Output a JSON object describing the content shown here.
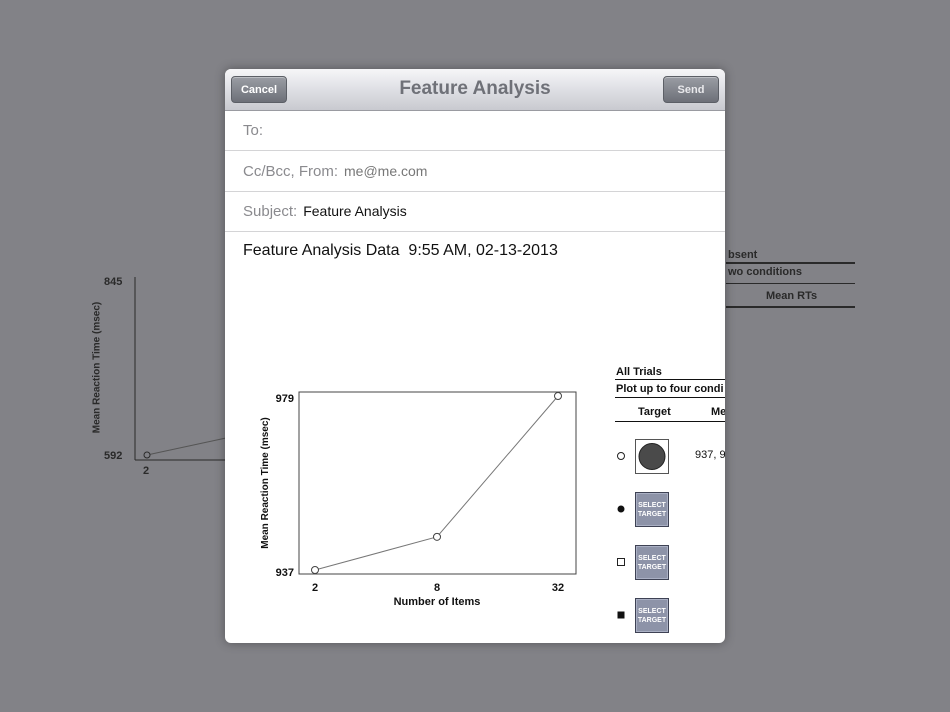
{
  "background_app": {
    "chart": {
      "ylabel": "Mean Reaction Time (msec)",
      "y_top_tick": "845",
      "y_bottom_tick": "592",
      "x_first_tick": "2"
    },
    "panel": {
      "line1": "bsent",
      "line2": "wo conditions",
      "line3": "Mean RTs"
    }
  },
  "mail": {
    "cancel_label": "Cancel",
    "title": "Feature Analysis",
    "send_label": "Send",
    "to_label": "To:",
    "to_value": "",
    "ccbcc_label": "Cc/Bcc, From:",
    "from_value": "me@me.com",
    "subject_label": "Subject:",
    "subject_value": "Feature Analysis",
    "body_text": "Feature Analysis Data  9:55 AM, 02-13-2013"
  },
  "results_panel": {
    "header": "All Trials",
    "subheader": "Plot up to four condi",
    "col_target": "Target",
    "col_mean": "Me",
    "row1_value": "937, 9",
    "select_label_1": "SELECT",
    "select_label_2": "TARGET"
  },
  "chart_data": {
    "type": "line",
    "x": [
      2,
      8,
      32
    ],
    "categories": [
      "2",
      "8",
      "32"
    ],
    "values": [
      937,
      945,
      979
    ],
    "xlabel": "Number of Items",
    "ylabel": "Mean Reaction Time (msec)",
    "ylim": [
      937,
      979
    ],
    "yticks": [
      "937",
      "979"
    ],
    "grid": false
  }
}
